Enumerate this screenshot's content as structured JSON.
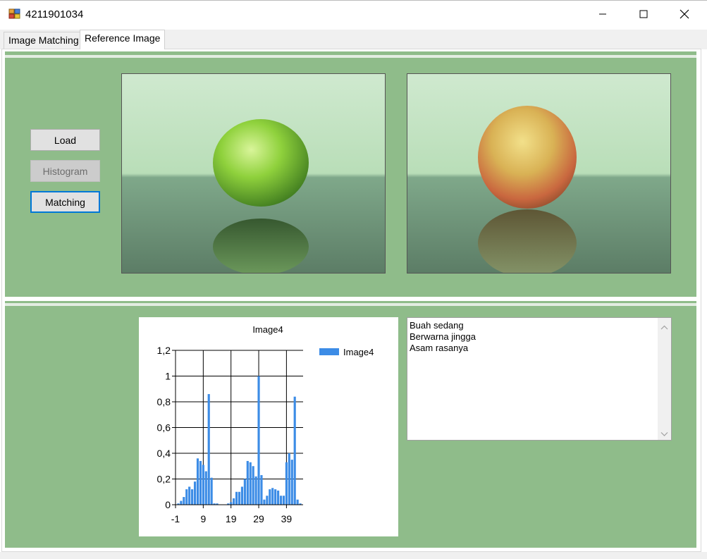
{
  "window": {
    "title": "4211901034",
    "minimize_icon": "minimize-icon",
    "maximize_icon": "maximize-icon",
    "close_icon": "close-icon"
  },
  "tabs": [
    {
      "label": "Image Matching",
      "selected": false
    },
    {
      "label": "Reference Image",
      "selected": true
    }
  ],
  "buttons": {
    "load": "Load",
    "histogram": "Histogram",
    "matching": "Matching"
  },
  "colors": {
    "panel": "#8fbc8a",
    "bar": "#3c8ce6",
    "focus": "#0078d7"
  },
  "images": {
    "left": "green-apple-photo",
    "right": "orange-apple-photo"
  },
  "chart_data": {
    "type": "bar",
    "title": "Image4",
    "legend": [
      "Image4"
    ],
    "legend_position": "right",
    "grid": true,
    "xlim": [
      -1,
      45
    ],
    "x_ticks": [
      "-1",
      "9",
      "19",
      "29",
      "39"
    ],
    "ylim": [
      0,
      1.2
    ],
    "y_ticks": [
      "0",
      "0,2",
      "0,4",
      "0,6",
      "0,8",
      "1",
      "1,2"
    ],
    "series": [
      {
        "name": "Image4",
        "x": [
          0,
          1,
          2,
          3,
          4,
          5,
          6,
          7,
          8,
          9,
          10,
          11,
          12,
          13,
          14,
          15,
          16,
          17,
          18,
          19,
          20,
          21,
          22,
          23,
          24,
          25,
          26,
          27,
          28,
          29,
          30,
          31,
          32,
          33,
          34,
          35,
          36,
          37,
          38,
          39,
          40,
          41,
          42,
          43,
          44
        ],
        "values": [
          0.01,
          0.03,
          0.06,
          0.12,
          0.14,
          0.12,
          0.18,
          0.36,
          0.34,
          0.31,
          0.26,
          0.86,
          0.21,
          0.01,
          0.01,
          0,
          0,
          0,
          0.01,
          0.02,
          0.05,
          0.1,
          0.1,
          0.14,
          0.2,
          0.34,
          0.33,
          0.3,
          0.22,
          1.0,
          0.23,
          0.04,
          0.07,
          0.12,
          0.13,
          0.12,
          0.11,
          0.07,
          0.07,
          0.33,
          0.4,
          0.35,
          0.84,
          0.04,
          0.01
        ]
      }
    ]
  },
  "textbox": {
    "lines": [
      "Buah sedang",
      "Berwarna jingga",
      "Asam rasanya"
    ]
  }
}
